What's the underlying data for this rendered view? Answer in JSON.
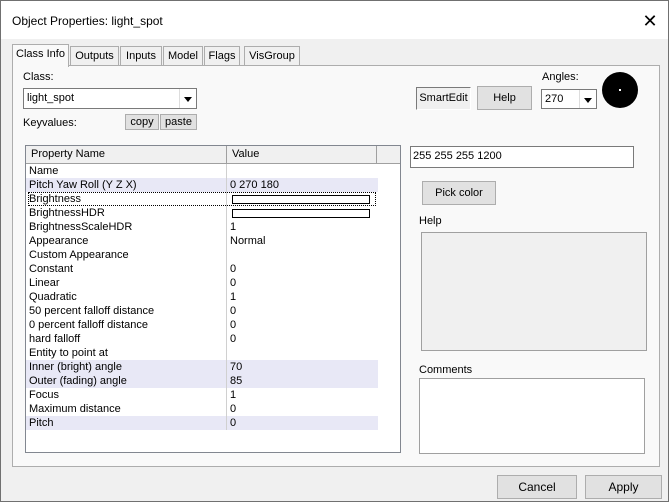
{
  "window": {
    "title": "Object Properties: light_spot",
    "close_glyph": "✕"
  },
  "tabs": [
    "Class Info",
    "Outputs",
    "Inputs",
    "Model",
    "Flags",
    "VisGroup"
  ],
  "class_section": {
    "label": "Class:",
    "value": "light_spot",
    "keyvalues_label": "Keyvalues:",
    "copy_label": "copy",
    "paste_label": "paste"
  },
  "top_right": {
    "smart_edit_label": "SmartEdit",
    "help_button_label": "Help",
    "angles_label": "Angles:",
    "angles_value": "270"
  },
  "grid": {
    "columns": [
      "Property Name",
      "Value"
    ],
    "rows": [
      {
        "name": "Name",
        "value": ""
      },
      {
        "name": "Pitch Yaw Roll (Y Z X)",
        "value": "0 270 180"
      },
      {
        "name": "Brightness",
        "value": ""
      },
      {
        "name": "BrightnessHDR",
        "value": ""
      },
      {
        "name": "BrightnessScaleHDR",
        "value": "1"
      },
      {
        "name": "Appearance",
        "value": "Normal"
      },
      {
        "name": "Custom Appearance",
        "value": ""
      },
      {
        "name": "Constant",
        "value": "0"
      },
      {
        "name": "Linear",
        "value": "0"
      },
      {
        "name": "Quadratic",
        "value": "1"
      },
      {
        "name": "50 percent falloff distance",
        "value": "0"
      },
      {
        "name": "0 percent falloff distance",
        "value": "0"
      },
      {
        "name": "hard falloff",
        "value": "0"
      },
      {
        "name": "Entity to point at",
        "value": ""
      },
      {
        "name": "Inner (bright) angle",
        "value": "70"
      },
      {
        "name": "Outer (fading) angle",
        "value": "85"
      },
      {
        "name": "Focus",
        "value": "1"
      },
      {
        "name": "Maximum distance",
        "value": "0"
      },
      {
        "name": "Pitch",
        "value": "0"
      }
    ]
  },
  "edit_panel": {
    "value_text": "255 255 255 1200",
    "pick_color_label": "Pick color",
    "help_label": "Help",
    "comments_label": "Comments"
  },
  "footer": {
    "cancel_label": "Cancel",
    "apply_label": "Apply"
  },
  "colors": {
    "row_highlight": "#e8e8f6",
    "swatch": "#ffffff",
    "dialog_bg": "#f0f0f0"
  }
}
